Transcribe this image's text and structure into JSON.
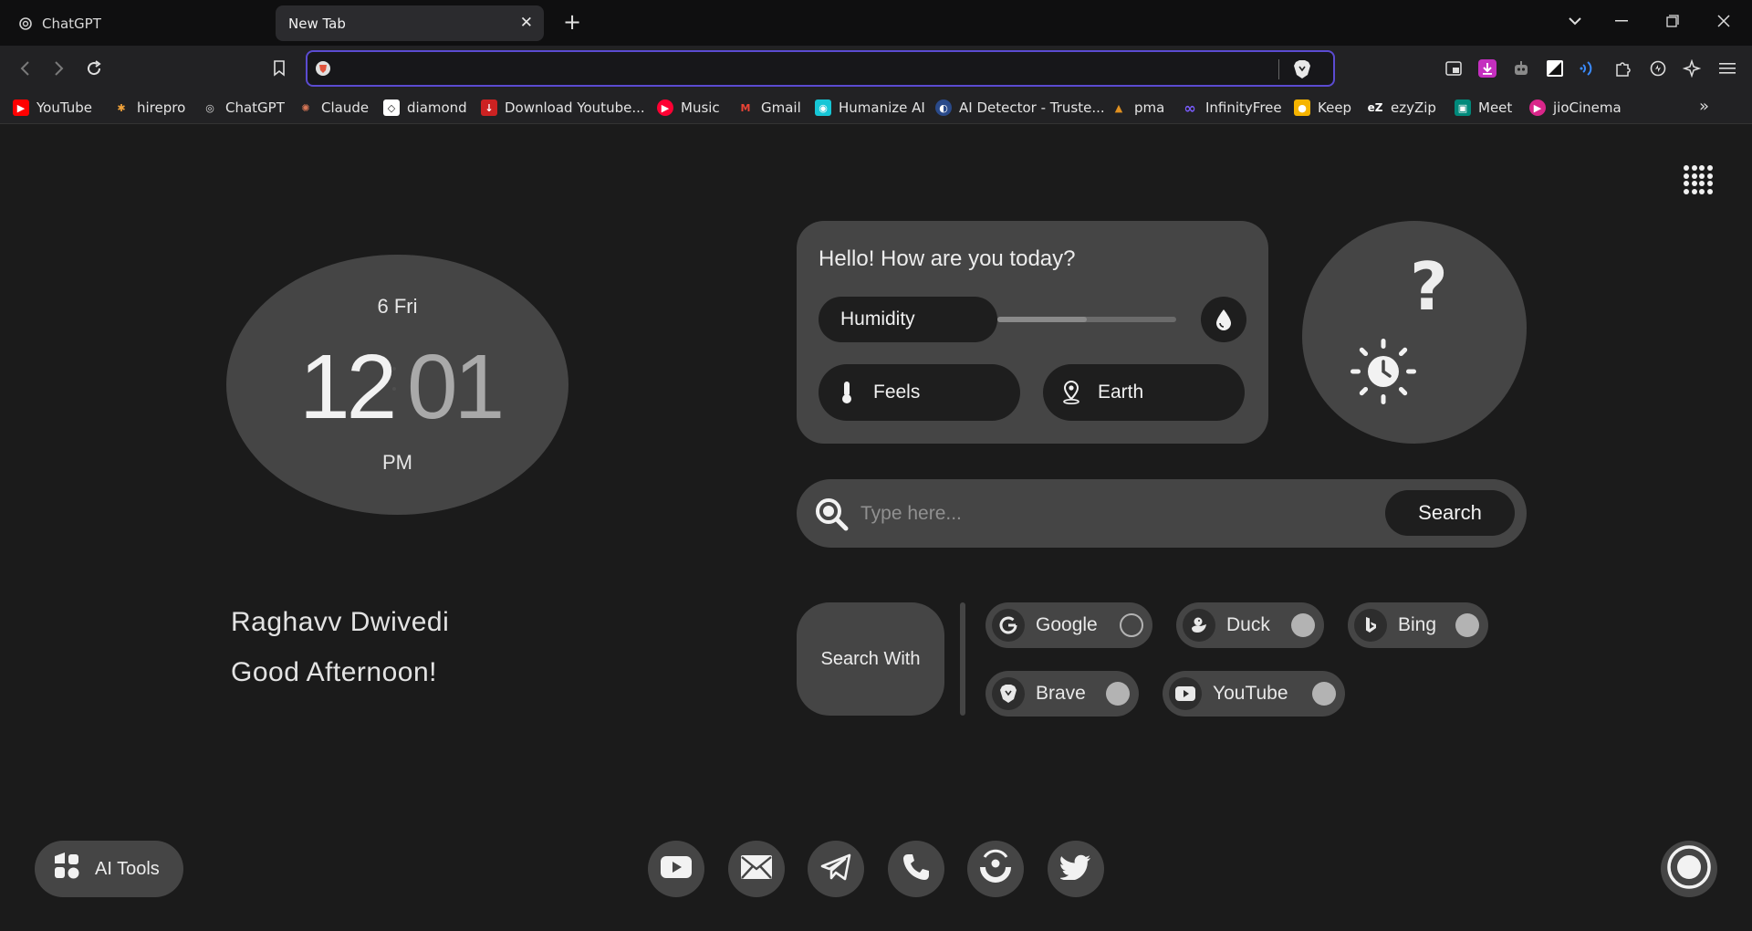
{
  "browser": {
    "tabs": [
      {
        "label": "ChatGPT",
        "active": false
      },
      {
        "label": "New Tab",
        "active": true
      }
    ],
    "address": {
      "value": "",
      "placeholder": ""
    },
    "bookmarks": [
      {
        "label": "YouTube",
        "icon": "youtube-icon",
        "color": "#ff0000"
      },
      {
        "label": "hirepro",
        "icon": "hirepro-icon",
        "color": "#f2a33a"
      },
      {
        "label": "ChatGPT",
        "icon": "chatgpt-icon",
        "color": "#444444"
      },
      {
        "label": "Claude",
        "icon": "claude-icon",
        "color": "#d97757"
      },
      {
        "label": "diamond",
        "icon": "diamond-icon",
        "color": "#ffffff"
      },
      {
        "label": "Download Youtube...",
        "icon": "download-youtube-icon",
        "color": "#cc2222"
      },
      {
        "label": "Music",
        "icon": "music-icon",
        "color": "#ff0033"
      },
      {
        "label": "Gmail",
        "icon": "gmail-icon",
        "color": "#ea4335"
      },
      {
        "label": "Humanize AI",
        "icon": "humanize-icon",
        "color": "#16c6d6"
      },
      {
        "label": "AI Detector - Truste...",
        "icon": "ai-detector-icon",
        "color": "#2a4a8a"
      },
      {
        "label": "pma",
        "icon": "pma-icon",
        "color": "#e09020"
      },
      {
        "label": "InfinityFree",
        "icon": "infinity-icon",
        "color": "#7a5cff"
      },
      {
        "label": "Keep",
        "icon": "keep-icon",
        "color": "#f6b400"
      },
      {
        "label": "ezyZip",
        "icon": "ezyzip-icon",
        "color": "#333333"
      },
      {
        "label": "Meet",
        "icon": "meet-icon",
        "color": "#00897b"
      },
      {
        "label": "jioCinema",
        "icon": "jiocinema-icon",
        "color": "#d9268a"
      }
    ]
  },
  "clock": {
    "date": "6 Fri",
    "hours": "12",
    "minutes": "01",
    "ampm": "PM"
  },
  "greeting": {
    "name": "Raghavv Dwivedi",
    "message": "Good Afternoon!"
  },
  "weather": {
    "hello": "Hello! How are you today?",
    "humidity_label": "Humidity",
    "humidity_level": 0.5,
    "feels_label": "Feels",
    "location_label": "Earth"
  },
  "search": {
    "placeholder": "Type here...",
    "button_label": "Search"
  },
  "search_with": {
    "label": "Search With",
    "engines": [
      {
        "label": "Google",
        "icon": "google-icon",
        "selected": true
      },
      {
        "label": "Duck",
        "icon": "duck-icon",
        "selected": false
      },
      {
        "label": "Bing",
        "icon": "bing-icon",
        "selected": false
      },
      {
        "label": "Brave",
        "icon": "brave-icon",
        "selected": false
      },
      {
        "label": "YouTube",
        "icon": "youtube-icon",
        "selected": false
      }
    ]
  },
  "ai_tools": {
    "label": "AI Tools"
  },
  "dock": [
    "youtube-icon",
    "mail-icon",
    "telegram-icon",
    "phone-icon",
    "camera-icon",
    "twitter-icon"
  ],
  "colors": {
    "accent": "#5b4bd1",
    "card": "#454545",
    "background": "#1b1b1b",
    "pill": "#1e1e1e"
  }
}
